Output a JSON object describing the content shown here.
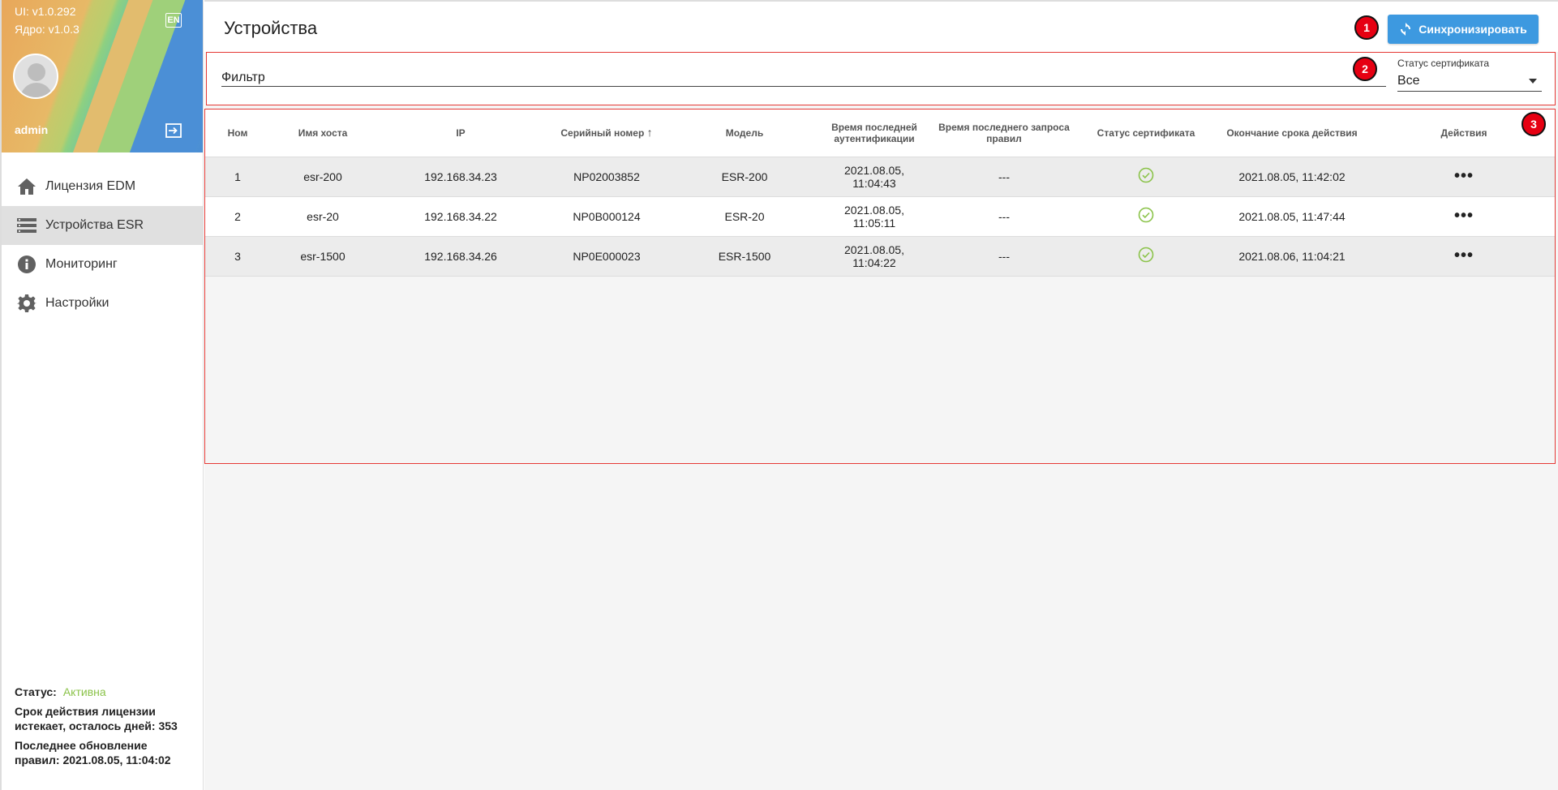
{
  "sidebar": {
    "ui_version": "UI: v1.0.292",
    "core_version": "Ядро: v1.0.3",
    "lang_label": "EN",
    "username": "admin",
    "nav": [
      {
        "label": "Лицензия EDM",
        "icon": "home-icon",
        "active": false
      },
      {
        "label": "Устройства ESR",
        "icon": "storage-icon",
        "active": true
      },
      {
        "label": "Мониторинг",
        "icon": "info-icon",
        "active": false
      },
      {
        "label": "Настройки",
        "icon": "gear-icon",
        "active": false
      }
    ],
    "footer": {
      "status_label": "Статус:",
      "status_value": "Активна",
      "license_text": "Срок действия лицензии истекает, осталось дней: 353",
      "rules_text": "Последнее обновление правил: 2021.08.05, 11:04:02"
    }
  },
  "header": {
    "title": "Устройства",
    "sync_label": "Синхронизировать"
  },
  "markers": [
    "1",
    "2",
    "3"
  ],
  "filter": {
    "placeholder": "Фильтр",
    "cert_status_label": "Статус сертификата",
    "cert_status_value": "Все"
  },
  "table": {
    "columns": [
      "Ном",
      "Имя хоста",
      "IP",
      "Серийный номер",
      "Модель",
      "Время последней аутентификации",
      "Время последнего запроса правил",
      "Статус сертификата",
      "Окончание срока действия",
      "Действия"
    ],
    "sort_indicator": "↑",
    "rows": [
      {
        "num": "1",
        "host": "esr-200",
        "ip": "192.168.34.23",
        "serial": "NP02003852",
        "model": "ESR-200",
        "auth_time": "2021.08.05, 11:04:43",
        "rules_time": "---",
        "cert_ok": true,
        "expiry": "2021.08.05, 11:42:02",
        "actions": "•••"
      },
      {
        "num": "2",
        "host": "esr-20",
        "ip": "192.168.34.22",
        "serial": "NP0B000124",
        "model": "ESR-20",
        "auth_time": "2021.08.05, 11:05:11",
        "rules_time": "---",
        "cert_ok": true,
        "expiry": "2021.08.05, 11:47:44",
        "actions": "•••"
      },
      {
        "num": "3",
        "host": "esr-1500",
        "ip": "192.168.34.26",
        "serial": "NP0E000023",
        "model": "ESR-1500",
        "auth_time": "2021.08.05, 11:04:22",
        "rules_time": "---",
        "cert_ok": true,
        "expiry": "2021.08.06, 11:04:21",
        "actions": "•••"
      }
    ]
  },
  "colors": {
    "accent": "#3d99e0",
    "status_active": "#8bc34a",
    "marker": "#e60012",
    "highlight_border": "#e53935"
  }
}
